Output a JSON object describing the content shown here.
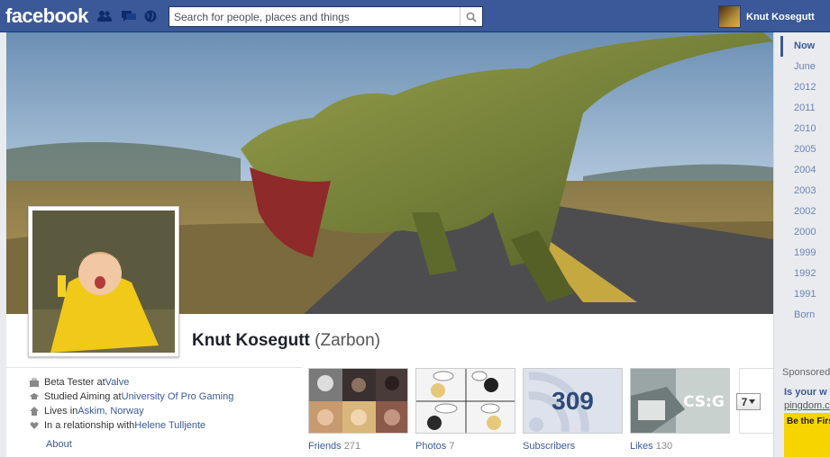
{
  "header": {
    "logo": "facebook",
    "search_placeholder": "Search for people, places and things",
    "user_name": "Knut Kosegutt"
  },
  "profile": {
    "name": "Knut Kosegutt",
    "alt_name": "(Zarbon)"
  },
  "info": [
    {
      "icon": "briefcase-icon",
      "prefix": "Beta Tester at ",
      "link": "Valve"
    },
    {
      "icon": "graduation-cap-icon",
      "prefix": "Studied Aiming at ",
      "link": "University Of Pro Gaming"
    },
    {
      "icon": "house-icon",
      "prefix": "Lives in ",
      "link": "Askim, Norway"
    },
    {
      "icon": "heart-icon",
      "prefix": "In a relationship with ",
      "link": "Helene Tulljente"
    }
  ],
  "about_label": "About",
  "tiles": [
    {
      "label": "Friends",
      "count": "271"
    },
    {
      "label": "Photos",
      "count": "7"
    },
    {
      "label": "Subscribers",
      "count": "",
      "big_number": "309"
    },
    {
      "label": "Likes",
      "count": "130"
    }
  ],
  "more_button": "7",
  "years": [
    "Now",
    "June",
    "2012",
    "2011",
    "2010",
    "2005",
    "2004",
    "2003",
    "2002",
    "2000",
    "1999",
    "1992",
    "1991",
    "Born"
  ],
  "active_year": "Now",
  "ad": {
    "sponsored_label": "Sponsored",
    "title": "Is your w",
    "url": "pingdom.c",
    "image_text": "Be the Firs"
  },
  "colors": {
    "brand_blue": "#3b5998",
    "link_blue": "#3b5998",
    "page_bg": "#e9ebee"
  }
}
